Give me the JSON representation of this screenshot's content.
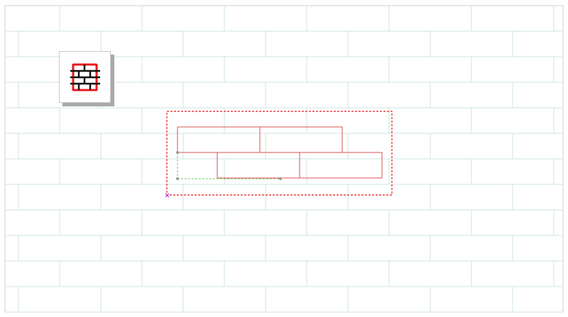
{
  "app": {
    "title": ""
  },
  "colors": {
    "background": "#ffffff",
    "brick_grid_line": "#cfe3e3",
    "border": "#c8c8c8",
    "selection_box": "#e8191d",
    "pattern_brick_stroke": "#d9534f",
    "guide_line": "#66cc66",
    "anchor_marker": "#cc33cc",
    "guide_point": "#999999"
  },
  "toolbar": {
    "brick_pattern_tool": {
      "icon": "brick-wall-icon",
      "tooltip": ""
    }
  },
  "pattern": {
    "name": "",
    "rows": [
      {
        "bricks": 2,
        "offset": "none"
      },
      {
        "bricks": 2,
        "offset": "half"
      }
    ]
  }
}
